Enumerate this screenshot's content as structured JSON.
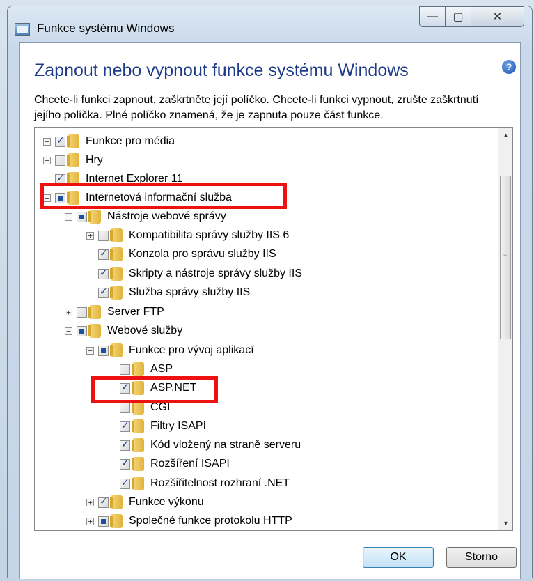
{
  "window": {
    "title": "Funkce systému Windows",
    "heading": "Zapnout nebo vypnout funkce systému Windows",
    "description": "Chcete-li funkci zapnout, zaškrtněte její políčko. Chcete-li funkci vypnout, zrušte zaškrtnutí jejího políčka. Plné políčko znamená, že je zapnuta pouze část funkce.",
    "help_icon": "?"
  },
  "title_buttons": {
    "minimize": "—",
    "maximize": "▢",
    "close": "✕"
  },
  "tree": [
    {
      "label": "Funkce pro média",
      "state": "checked",
      "expander": "+"
    },
    {
      "label": "Hry",
      "state": "unchecked",
      "expander": "+"
    },
    {
      "label": "Internet Explorer 11",
      "state": "checked",
      "expander": ""
    },
    {
      "label": "Internetová informační služba",
      "state": "partial",
      "expander": "−"
    },
    {
      "label": "Nástroje webové správy",
      "state": "partial",
      "expander": "−"
    },
    {
      "label": "Kompatibilita správy služby IIS 6",
      "state": "unchecked",
      "expander": "+"
    },
    {
      "label": "Konzola pro správu služby IIS",
      "state": "checked",
      "expander": ""
    },
    {
      "label": "Skripty a nástroje správy služby IIS",
      "state": "checked",
      "expander": ""
    },
    {
      "label": "Služba správy služby IIS",
      "state": "checked",
      "expander": ""
    },
    {
      "label": "Server FTP",
      "state": "unchecked",
      "expander": "+"
    },
    {
      "label": "Webové služby",
      "state": "partial",
      "expander": "−"
    },
    {
      "label": "Funkce pro vývoj aplikací",
      "state": "partial",
      "expander": "−"
    },
    {
      "label": "ASP",
      "state": "unchecked",
      "expander": ""
    },
    {
      "label": "ASP.NET",
      "state": "checked",
      "expander": ""
    },
    {
      "label": "CGI",
      "state": "unchecked",
      "expander": ""
    },
    {
      "label": "Filtry ISAPI",
      "state": "checked",
      "expander": ""
    },
    {
      "label": "Kód vložený na straně serveru",
      "state": "checked",
      "expander": ""
    },
    {
      "label": "Rozšíření ISAPI",
      "state": "checked",
      "expander": ""
    },
    {
      "label": "Rozšiřitelnost rozhraní .NET",
      "state": "checked",
      "expander": ""
    },
    {
      "label": "Funkce výkonu",
      "state": "checked",
      "expander": "+"
    },
    {
      "label": "Společné funkce protokolu HTTP",
      "state": "partial",
      "expander": "+"
    }
  ],
  "buttons": {
    "ok": "OK",
    "cancel": "Storno"
  },
  "colors": {
    "heading": "#1e3b8a",
    "highlight": "#ee1111",
    "ok_border": "#3c7fb1"
  }
}
